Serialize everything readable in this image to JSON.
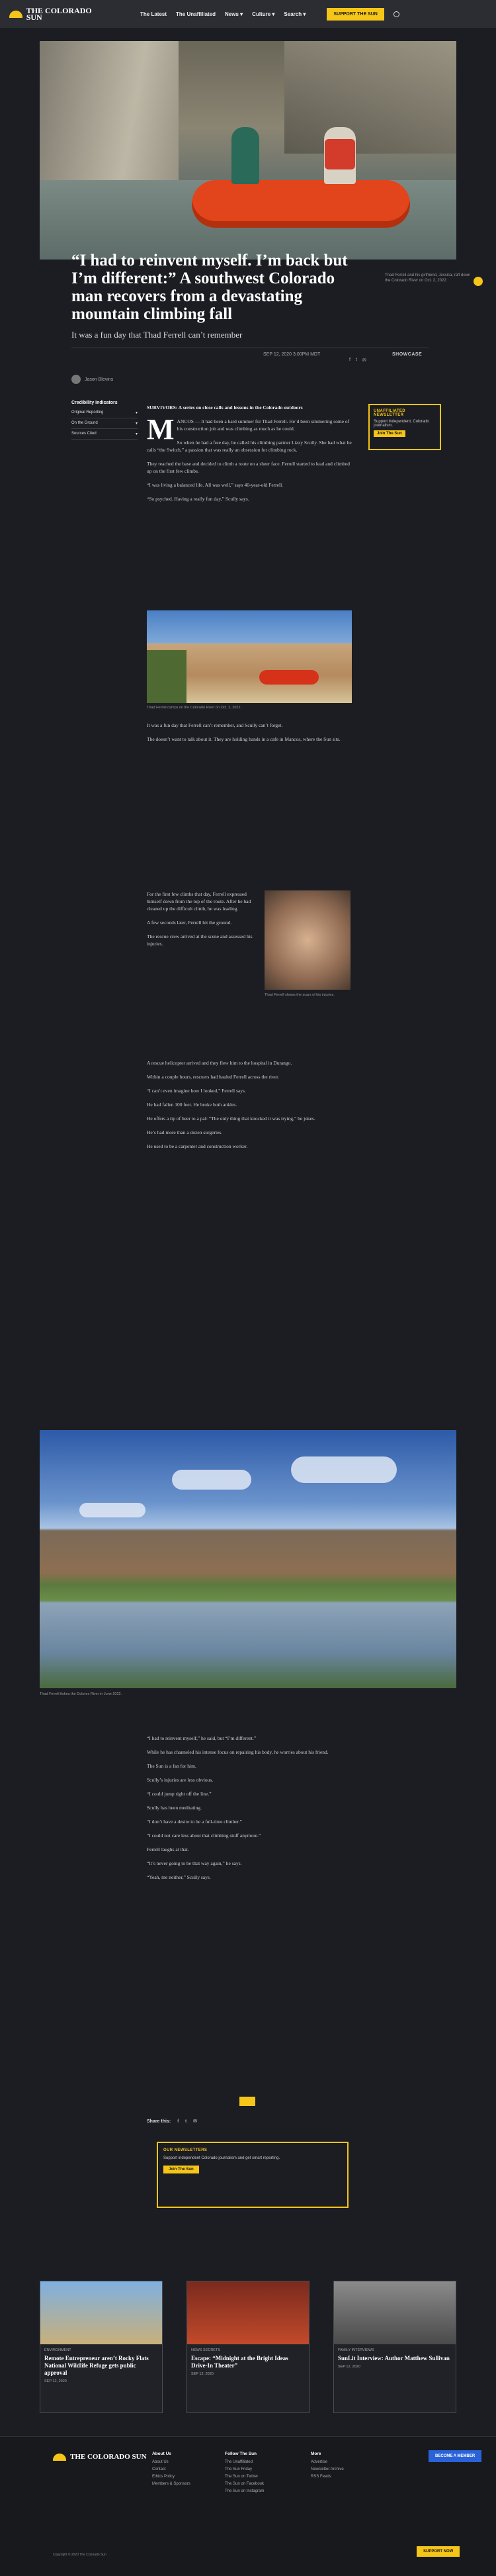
{
  "header": {
    "logo": "THE COLORADO SUN",
    "nav": [
      "The Latest",
      "The Unaffiliated",
      "News ▾",
      "Culture ▾",
      "Search ▾"
    ],
    "cta": "SUPPORT THE SUN"
  },
  "hero": {
    "caption": "Thad Ferrell and his girlfriend, Jessica, raft down the Colorado River on Oct. 2, 2022."
  },
  "article": {
    "headline": "“I had to reinvent myself. I’m back but I’m different:” A southwest Colorado man recovers from a devastating mountain climbing fall",
    "dek": "It was a fun day that Thad Ferrell can’t remember",
    "date": "SEP 12, 2020 3:00PM MDT",
    "category": "SHOWCASE",
    "author": "Jason Blevins",
    "sidebar_title": "Credibility Indicators",
    "sidebar_items": [
      "Original Reporting",
      "On the Ground",
      "Sources Cited"
    ],
    "kicker": "SURVIVORS: A series on close calls and lessons in the Colorado outdoors",
    "p1": "ANCOS — It had been a hard summer for Thad Ferrell. He’d been simmering some of his construction job and was climbing as much as he could.",
    "p2": "So when he had a free day, he called his climbing partner Lizzy Scully. She had what he calls “the Switch,” a passion that was really an obsession for climbing rock.",
    "p3": "They reached the base and decided to climb a route on a sheer face. Ferrell started to lead and climbed up on the first few climbs.",
    "p4": "“I was living a balanced life. All was well,” says 40-year-old Ferrell.",
    "p5": "“So psyched. Having a really fun day,” Scully says.",
    "fig1": "Thad Ferrell camps on the Colorado River on Oct. 2, 2022.",
    "p6": "It was a fun day that Ferrell can’t remember, and Scully can’t forget.",
    "p7": "The doesn’t want to talk about it. They are holding hands in a cafe in Mancos, where the Sun sits.",
    "p8": "For the first few climbs that day, Ferrell expressed himself down from the top of the route. After he had cleaned up the difficult climb, he was leading.",
    "fig2": "Thad Ferrell shows the scars of his injuries.",
    "p9": "A few seconds later, Ferrell hit the ground.",
    "p10": "The rescue crew arrived at the scene and assessed his injuries.",
    "p11": "A rescue helicopter arrived and they flew him to the hospital in Durango.",
    "p12": "Within a couple hours, rescuers had hauled Ferrell across the river.",
    "p13": "“I can’t even imagine how I looked,” Ferrell says.",
    "p14": "He had fallen 100 feet. He broke both ankles.",
    "p15": "He offers a tip of beer to a pal: “The only thing that knocked it was trying,” he jokes.",
    "p16": "He’s had more than a dozen surgeries.",
    "p17": "He used to be a carpenter and construction worker.",
    "fig3": "Thad Ferrell fishes the Dolores River in June 2022.",
    "p18": "“I had to reinvent myself,” he said, but “I’m different.”",
    "p19": "While he has channeled his intense focus on repairing his body, he worries about his friend.",
    "p20": "The Sun is a fan for him.",
    "p21": "Scully’s injuries are less obvious.",
    "p22": "“I could jump right off the line.”",
    "p23": "Scully has been meditating.",
    "p24": "“I don’t have a desire to be a full-time climber.”",
    "p25": "“I could not care less about that climbing stuff anymore.”",
    "p26": "Ferrell laughs at that.",
    "p27": "“It’s never going to be that way again,” he says.",
    "p28": "“Yeah, me neither,” Scully says.",
    "share_label": "Share this:"
  },
  "cards": {
    "y1_title": "UNAFFILIATED NEWSLETTER",
    "y1_text": "Support Independent, Colorado journalism.",
    "y1_btn": "Join The Sun",
    "box_title": "OUR NEWSLETTERS",
    "box_text": "Support independent Colorado journalism and get smart reporting.",
    "box_btn": "Join The Sun"
  },
  "related": [
    {
      "tag": "ENVIRONMENT",
      "title": "Remote Entrepreneur aren’t Rocky Flats National Wildlife Refuge gets public approval",
      "date": "SEP 12, 2020"
    },
    {
      "tag": "NEWS SECRETS",
      "title": "Escape: “Midnight at the Bright Ideas Drive-In Theater”",
      "date": "SEP 12, 2020"
    },
    {
      "tag": "FAMILY INTERVIEWS",
      "title": "SunLit Interview: Author Matthew Sullivan",
      "date": "SEP 12, 2020"
    }
  ],
  "footer": {
    "logo": "THE COLORADO SUN",
    "col1_title": "About Us",
    "col1": [
      "About Us",
      "Contact",
      "Ethics Policy",
      "Members & Sponsors"
    ],
    "col2_title": "Follow The Sun",
    "col2": [
      "The Unaffiliated",
      "The Sun Friday",
      "The Sun on Twitter",
      "The Sun on Facebook",
      "The Sun on Instagram"
    ],
    "col3_title": "More",
    "col3": [
      "Advertise",
      "Newsletter Archive",
      "RSS Feeds"
    ],
    "btn": "BECOME A MEMBER",
    "copy": "Copyright © 2020 The Colorado Sun",
    "sub": "SUPPORT NOW"
  }
}
